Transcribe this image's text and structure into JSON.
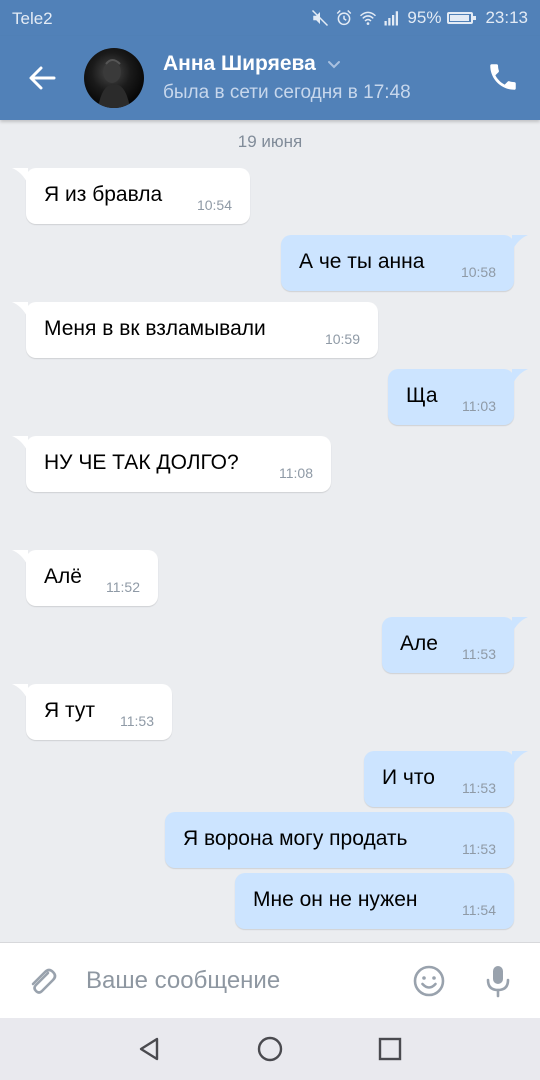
{
  "status_bar": {
    "carrier": "Tele2",
    "battery": "95%",
    "battery_level": 0.95,
    "time": "23:13",
    "icons": [
      "mute-icon",
      "alarm-icon",
      "wifi-icon",
      "signal-icon",
      "battery-icon"
    ]
  },
  "header": {
    "contact_name": "Анна Ширяева",
    "status": "была в сети сегодня в 17:48",
    "icons": [
      "back-arrow-icon",
      "avatar",
      "chevron-down-icon",
      "phone-icon"
    ]
  },
  "chat": {
    "date": "19 июня",
    "messages": [
      {
        "direction": "in",
        "text": "Я из бравла",
        "time": "10:54"
      },
      {
        "direction": "out",
        "text": "А че ты анна",
        "time": "10:58"
      },
      {
        "direction": "in",
        "text": "Меня в вк взламывали",
        "time": "10:59"
      },
      {
        "direction": "out",
        "text": "Ща",
        "time": "11:03"
      },
      {
        "direction": "in",
        "text": "НУ ЧЕ ТАК ДОЛГО?",
        "time": "11:08"
      },
      {
        "direction": "in",
        "text": "Алё",
        "time": "11:52"
      },
      {
        "direction": "out",
        "text": "Але",
        "time": "11:53"
      },
      {
        "direction": "in",
        "text": "Я тут",
        "time": "11:53"
      },
      {
        "direction": "out",
        "text": "И что",
        "time": "11:53"
      },
      {
        "direction": "out",
        "text": "Я ворона могу продать",
        "time": "11:53"
      },
      {
        "direction": "out",
        "text": "Мне он не нужен",
        "time": "11:54"
      }
    ]
  },
  "composer": {
    "placeholder": "Ваше сообщение",
    "value": "",
    "icons": [
      "paperclip-icon",
      "emoji-icon",
      "microphone-icon"
    ]
  },
  "nav_bar": {
    "icons": [
      "nav-back-icon",
      "nav-home-icon",
      "nav-recents-icon"
    ]
  },
  "colors": {
    "header_bg": "#5181b8",
    "chat_bg": "#ebedf0",
    "incoming_bubble": "#ffffff",
    "outgoing_bubble": "#cce4ff",
    "time_text": "#8f9aa6",
    "nav_bg": "#e9e9ee"
  }
}
